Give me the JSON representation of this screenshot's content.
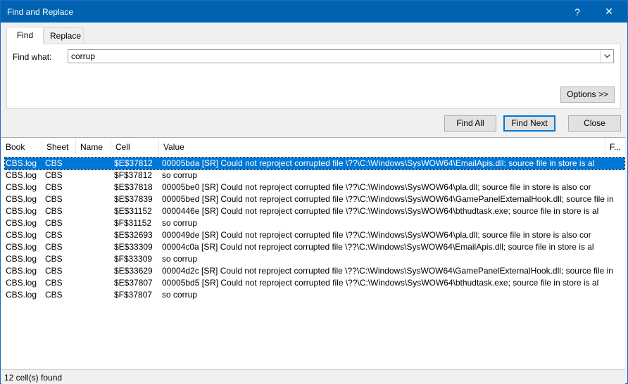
{
  "window": {
    "title": "Find and Replace",
    "help_glyph": "?",
    "close_glyph": "✕"
  },
  "tabs": {
    "find": "Find",
    "replace": "Replace"
  },
  "find": {
    "label": "Find what:",
    "value": "corrup",
    "dropdown_glyph": "⌄"
  },
  "buttons": {
    "options": "Options >>",
    "find_all": "Find All",
    "find_next": "Find Next",
    "close": "Close"
  },
  "results": {
    "columns": [
      "Book",
      "Sheet",
      "Name",
      "Cell",
      "Value",
      "F..."
    ],
    "rows": [
      {
        "book": "CBS.log",
        "sheet": "CBS",
        "name": "",
        "cell": "$E$37812",
        "value": "00005bda [SR] Could not reproject corrupted file \\??\\C:\\Windows\\SysWOW64\\EmailApis.dll; source file in store is al"
      },
      {
        "book": "CBS.log",
        "sheet": "CBS",
        "name": "",
        "cell": "$F$37812",
        "value": "so corrup"
      },
      {
        "book": "CBS.log",
        "sheet": "CBS",
        "name": "",
        "cell": "$E$37818",
        "value": "00005be0 [SR] Could not reproject corrupted file \\??\\C:\\Windows\\SysWOW64\\pla.dll; source file in store is also cor"
      },
      {
        "book": "CBS.log",
        "sheet": "CBS",
        "name": "",
        "cell": "$E$37839",
        "value": "00005bed [SR] Could not reproject corrupted file \\??\\C:\\Windows\\SysWOW64\\GamePanelExternalHook.dll; source file in"
      },
      {
        "book": "CBS.log",
        "sheet": "CBS",
        "name": "",
        "cell": "$E$31152",
        "value": "0000446e [SR] Could not reproject corrupted file \\??\\C:\\Windows\\SysWOW64\\bthudtask.exe; source file in store is al"
      },
      {
        "book": "CBS.log",
        "sheet": "CBS",
        "name": "",
        "cell": "$F$31152",
        "value": "so corrup"
      },
      {
        "book": "CBS.log",
        "sheet": "CBS",
        "name": "",
        "cell": "$E$32693",
        "value": "000049de [SR] Could not reproject corrupted file \\??\\C:\\Windows\\SysWOW64\\pla.dll; source file in store is also cor"
      },
      {
        "book": "CBS.log",
        "sheet": "CBS",
        "name": "",
        "cell": "$E$33309",
        "value": "00004c0a [SR] Could not reproject corrupted file \\??\\C:\\Windows\\SysWOW64\\EmailApis.dll; source file in store is al"
      },
      {
        "book": "CBS.log",
        "sheet": "CBS",
        "name": "",
        "cell": "$F$33309",
        "value": "so corrup"
      },
      {
        "book": "CBS.log",
        "sheet": "CBS",
        "name": "",
        "cell": "$E$33629",
        "value": "00004d2c [SR] Could not reproject corrupted file \\??\\C:\\Windows\\SysWOW64\\GamePanelExternalHook.dll; source file in"
      },
      {
        "book": "CBS.log",
        "sheet": "CBS",
        "name": "",
        "cell": "$E$37807",
        "value": "00005bd5 [SR] Could not reproject corrupted file \\??\\C:\\Windows\\SysWOW64\\bthudtask.exe; source file in store is al"
      },
      {
        "book": "CBS.log",
        "sheet": "CBS",
        "name": "",
        "cell": "$F$37807",
        "value": "so corrup"
      }
    ]
  },
  "status": {
    "text": "12 cell(s) found"
  }
}
